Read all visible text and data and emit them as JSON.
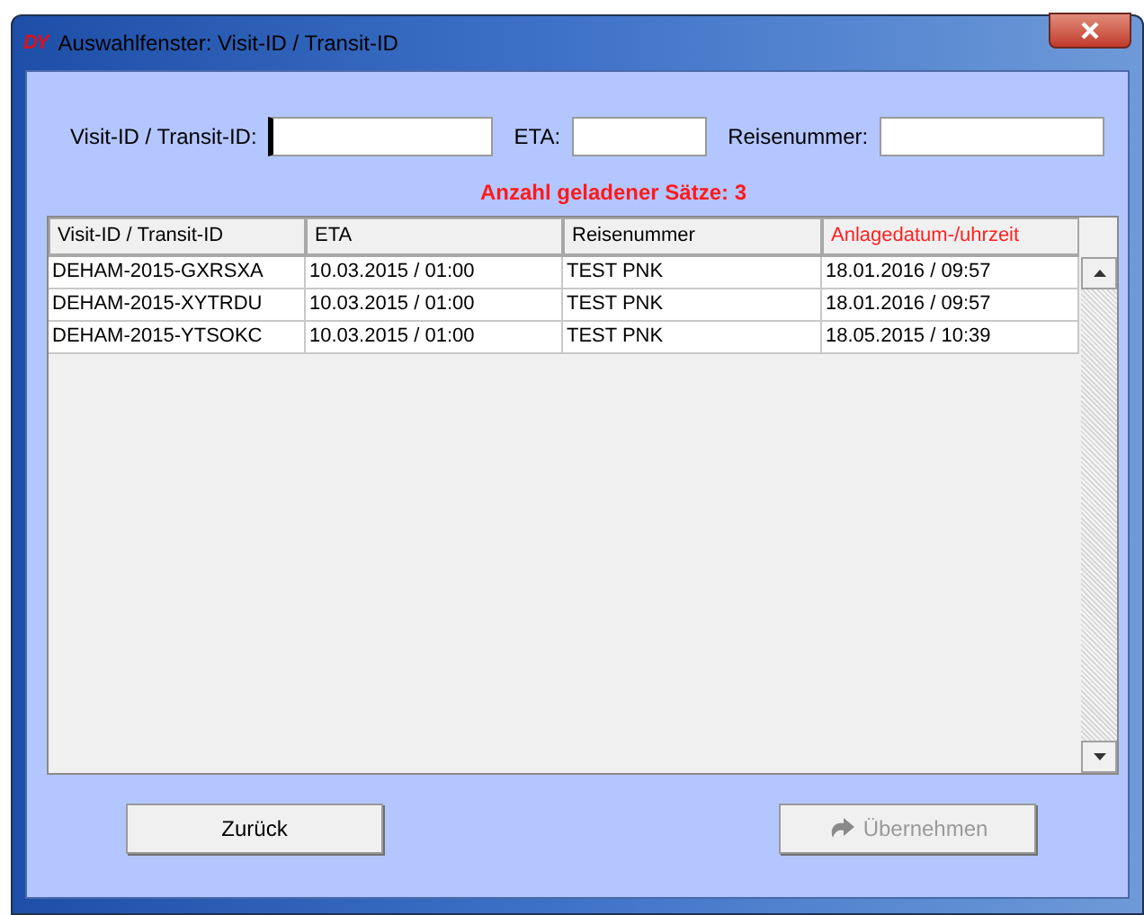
{
  "window": {
    "title": "Auswahlfenster: Visit-ID / Transit-ID",
    "app_logo": "DY"
  },
  "filters": [
    {
      "label": "Visit-ID / Transit-ID:",
      "focused": true
    },
    {
      "label": "ETA:",
      "focused": false
    },
    {
      "label": "Reisenummer:",
      "focused": false
    }
  ],
  "count_label": "Anzahl geladener Sätze: 3",
  "table": {
    "columns": [
      {
        "label": "Visit-ID / Transit-ID",
        "sorted": false
      },
      {
        "label": "ETA",
        "sorted": false
      },
      {
        "label": "Reisenummer",
        "sorted": false
      },
      {
        "label": "Anlagedatum-/uhrzeit",
        "sorted": true
      }
    ],
    "rows": [
      [
        "DEHAM-2015-GXRSXA",
        "10.03.2015 / 01:00",
        "TEST PNK",
        "18.01.2016 / 09:57"
      ],
      [
        "DEHAM-2015-XYTRDU",
        "10.03.2015 / 01:00",
        "TEST PNK",
        "18.01.2016 / 09:57"
      ],
      [
        "DEHAM-2015-YTSOKC",
        "10.03.2015 / 01:00",
        "TEST PNK",
        "18.05.2015 / 10:39"
      ]
    ]
  },
  "buttons": [
    {
      "label": "Zurück",
      "disabled": false,
      "icon": false
    },
    {
      "label": "Übernehmen",
      "disabled": true,
      "icon": true
    }
  ]
}
